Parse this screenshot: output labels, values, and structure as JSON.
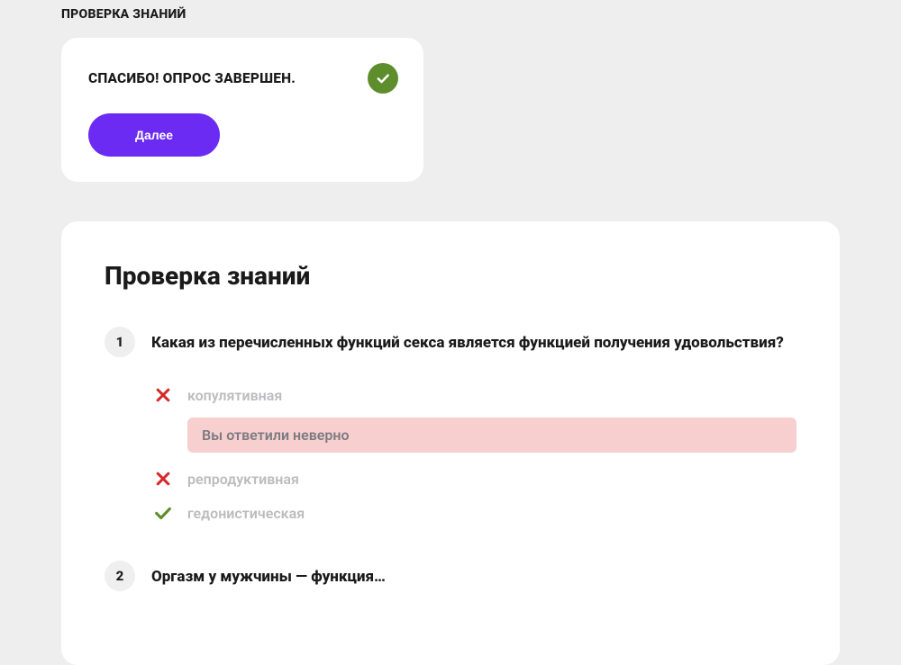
{
  "section_label": "ПРОВЕРКА ЗНАНИЙ",
  "completion": {
    "message": "СПАСИБО! ОПРОС ЗАВЕРШЕН.",
    "next_label": "Далее"
  },
  "results": {
    "title": "Проверка знаний",
    "questions": [
      {
        "number": "1",
        "text": "Какая из перечисленных функций секса является функцией получения удовольствия?",
        "answers": [
          {
            "text": "копулятивная",
            "status": "wrong"
          },
          {
            "text": "репродуктивная",
            "status": "wrong"
          },
          {
            "text": "гедонистическая",
            "status": "correct"
          }
        ],
        "feedback_after_first": "Вы ответили неверно"
      },
      {
        "number": "2",
        "text": "Оргазм у мужчины — функция…"
      }
    ]
  },
  "colors": {
    "accent": "#6b2bf2",
    "success": "#5e8d2d",
    "error": "#d6282a"
  }
}
